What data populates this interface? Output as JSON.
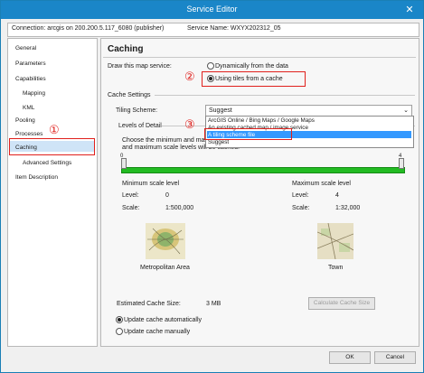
{
  "window": {
    "title": "Service Editor",
    "close_glyph": "✕"
  },
  "connection": {
    "text": "Connection: arcgis on 200.200.5.117_6080 (publisher)",
    "service": "Service Name: WXYX202312_05"
  },
  "sidebar": {
    "items": [
      {
        "label": "General"
      },
      {
        "label": "Parameters"
      },
      {
        "label": "Capabilities"
      },
      {
        "label": "Mapping"
      },
      {
        "label": "KML"
      },
      {
        "label": "Pooling"
      },
      {
        "label": "Processes"
      },
      {
        "label": "Caching"
      },
      {
        "label": "Advanced Settings"
      },
      {
        "label": "Item Description"
      }
    ],
    "selected": "Caching"
  },
  "main": {
    "heading": "Caching",
    "draw_label": "Draw this map service:",
    "draw_options": [
      {
        "label": "Dynamically from the data",
        "checked": false
      },
      {
        "label": "Using tiles from a cache",
        "checked": true
      }
    ],
    "cache_settings_label": "Cache Settings",
    "tiling_label": "Tiling Scheme:",
    "tiling_value": "Suggest",
    "tiling_options": [
      "ArcGIS Online / Bing Maps / Google Maps",
      "An existing cached map / image service",
      "A tiling scheme file",
      "Suggest"
    ],
    "tiling_highlighted": "A tiling scheme file",
    "lod_label": "Levels of Detail",
    "lod_desc_1": "Choose the minimum and maxim",
    "lod_desc_2": "and maximum scale levels will be cached.",
    "slider": {
      "min": 0,
      "max": 4,
      "min_label": "0",
      "max_label": "4"
    },
    "min_scale": {
      "title": "Minimum scale level",
      "level_label": "Level:",
      "level": "0",
      "scale_label": "Scale:",
      "scale": "1:500,000",
      "preview_caption": "Metropolitan Area"
    },
    "max_scale": {
      "title": "Maximum scale level",
      "level_label": "Level:",
      "level": "4",
      "scale_label": "Scale:",
      "scale": "1:32,000",
      "preview_caption": "Town"
    },
    "est_label": "Estimated Cache Size:",
    "est_value": "3 MB",
    "calc_button": "Calculate Cache Size",
    "update_options": [
      {
        "label": "Update cache automatically",
        "checked": true
      },
      {
        "label": "Update cache manually",
        "checked": false
      }
    ]
  },
  "footer": {
    "ok": "OK",
    "cancel": "Cancel"
  },
  "annotations": {
    "one": "①",
    "two": "②",
    "three": "③"
  },
  "colors": {
    "title_bar": "#1a86c8",
    "slider": "#22bb22",
    "annotation": "#e0201c",
    "selection": "#3399ff"
  }
}
